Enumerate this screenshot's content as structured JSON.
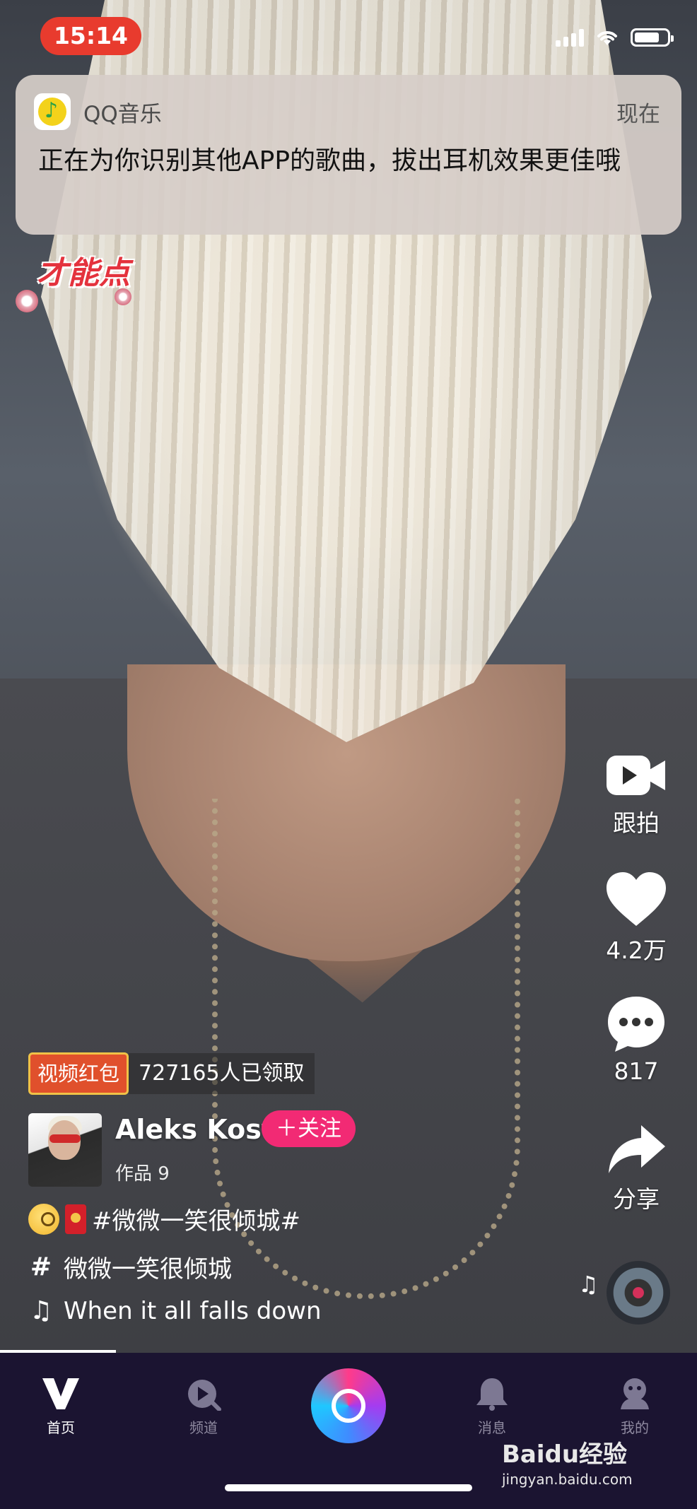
{
  "status_bar": {
    "time": "15:14"
  },
  "notification": {
    "app_name": "QQ音乐",
    "time": "现在",
    "message": "正在为你识别其他APP的歌曲，拔出耳机效果更佳哦"
  },
  "sticker": {
    "text": "才能点"
  },
  "right_rail": {
    "duet_label": "跟拍",
    "likes": "4.2万",
    "comments": "817",
    "share_label": "分享"
  },
  "video_info": {
    "redpacket_badge": "视频红包",
    "redpacket_count": "727165人已领取",
    "username": "Aleks Kost",
    "follow_label": "＋关注",
    "works_label": "作品 9",
    "caption": "#微微一笑很倾城#",
    "topic": "微微一笑很倾城",
    "music": "When it all falls down"
  },
  "tab_bar": {
    "items": [
      {
        "label": "首页",
        "icon": "v-logo-icon"
      },
      {
        "label": "频道",
        "icon": "channel-play-icon"
      },
      {
        "label": "",
        "icon": "record-camera-icon"
      },
      {
        "label": "消息",
        "icon": "bell-icon"
      },
      {
        "label": "我的",
        "icon": "profile-icon"
      }
    ]
  },
  "watermark": {
    "brand": "Baidu经验",
    "url": "jingyan.baidu.com"
  },
  "colors": {
    "follow": "#f22a74",
    "status_time_bg": "#e83b2e",
    "tabbar_bg": "#1b1431"
  }
}
